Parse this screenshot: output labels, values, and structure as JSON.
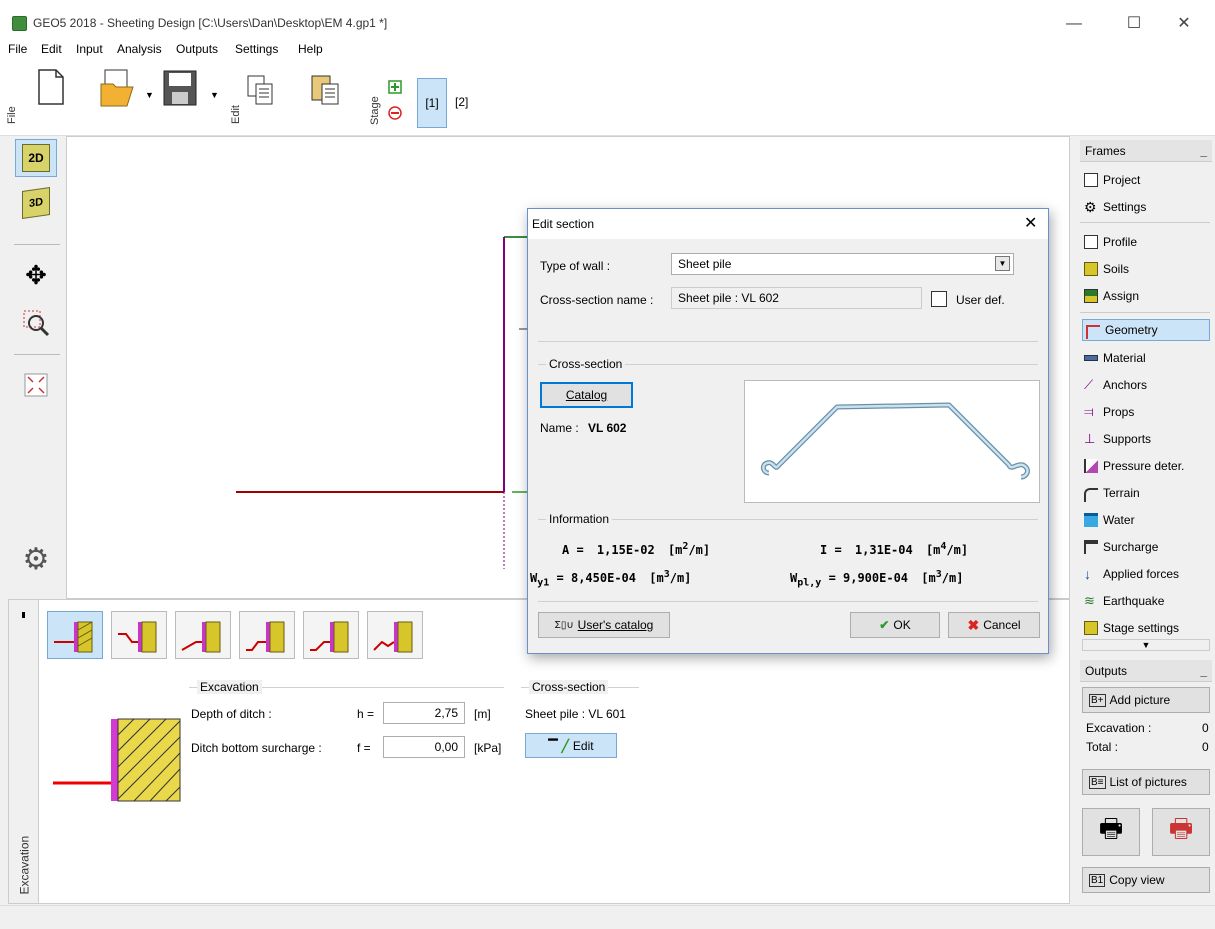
{
  "window": {
    "title": "GEO5 2018 - Sheeting Design [C:\\Users\\Dan\\Desktop\\EM 4.gp1 *]",
    "minimize": "—",
    "maximize": "☐",
    "close": "✕"
  },
  "menu": [
    "File",
    "Edit",
    "Input",
    "Analysis",
    "Outputs",
    "Settings",
    "Help"
  ],
  "toolbar": {
    "file_label": "File",
    "edit_label": "Edit",
    "stage_label": "Stage",
    "stage1": "[1]",
    "stage2": "[2]"
  },
  "left_tools": {
    "btn_2d": "2D",
    "btn_3d": "3D"
  },
  "frames": {
    "header": "Frames",
    "items": [
      "Project",
      "Settings",
      "Profile",
      "Soils",
      "Assign",
      "Geometry",
      "Material",
      "Anchors",
      "Props",
      "Supports",
      "Pressure deter.",
      "Terrain",
      "Water",
      "Surcharge",
      "Applied forces",
      "Earthquake",
      "Stage settings"
    ],
    "active": "Geometry"
  },
  "outputs": {
    "header": "Outputs",
    "add_picture": "Add picture",
    "excavation_label": "Excavation :",
    "excavation_count": "0",
    "total_label": "Total :",
    "total_count": "0",
    "list_pictures": "List of pictures",
    "copy_view": "Copy view"
  },
  "bottom": {
    "side_label": "Excavation",
    "excavation_group": "Excavation",
    "depth_label": "Depth of ditch :",
    "depth_sym": "h =",
    "depth_value": "2,75",
    "depth_unit": "[m]",
    "surcharge_label": "Ditch bottom surcharge :",
    "surcharge_sym": "f =",
    "surcharge_value": "0,00",
    "surcharge_unit": "[kPa]",
    "cross_group": "Cross-section",
    "cross_name": "Sheet pile : VL 601",
    "edit_btn": "Edit"
  },
  "dialog": {
    "title": "Edit section",
    "type_label": "Type of wall :",
    "type_value": "Sheet pile",
    "cs_name_label": "Cross-section name :",
    "cs_name_value": "Sheet pile : VL 602",
    "user_def": "User def.",
    "cross_group": "Cross-section",
    "catalog_btn": "Catalog",
    "name_label": "Name :",
    "name_value": "VL 602",
    "info_group": "Information",
    "A_label": "A =",
    "A_value": "1,15E-02",
    "A_unit_base": "[m",
    "A_unit_exp": "2",
    "A_unit_tail": "/m]",
    "I_label": "I =",
    "I_value": "1,31E-04",
    "I_unit_base": "[m",
    "I_unit_exp": "4",
    "I_unit_tail": "/m]",
    "W_label": "W",
    "W_sub": "y1",
    "W_value": "= 8,450E-04",
    "W_unit_base": "[m",
    "W_unit_exp": "3",
    "W_unit_tail": "/m]",
    "Wpl_label": "W",
    "Wpl_sub": "pl,y",
    "Wpl_value": "= 9,900E-04",
    "Wpl_unit_base": "[m",
    "Wpl_unit_exp": "3",
    "Wpl_unit_tail": "/m]",
    "users_catalog_btn": "User's catalog",
    "ok_btn": "OK",
    "cancel_btn": "Cancel"
  },
  "colors": {
    "accent": "#cce4f7",
    "ground": "#a00000",
    "wall": "#800080"
  }
}
